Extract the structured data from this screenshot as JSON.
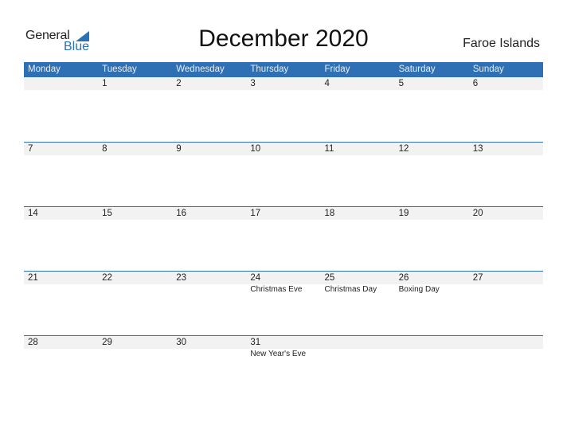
{
  "logo": {
    "general": "General",
    "blue": "Blue",
    "icon": "triangle-flag-icon"
  },
  "title": "December 2020",
  "country": "Faroe Islands",
  "colors": {
    "accent": "#2e70b3",
    "band": "#f2f2f2"
  },
  "weekdays": [
    "Monday",
    "Tuesday",
    "Wednesday",
    "Thursday",
    "Friday",
    "Saturday",
    "Sunday"
  ],
  "weeks": [
    {
      "days": [
        {
          "n": "",
          "h": ""
        },
        {
          "n": "1",
          "h": ""
        },
        {
          "n": "2",
          "h": ""
        },
        {
          "n": "3",
          "h": ""
        },
        {
          "n": "4",
          "h": ""
        },
        {
          "n": "5",
          "h": ""
        },
        {
          "n": "6",
          "h": ""
        }
      ]
    },
    {
      "days": [
        {
          "n": "7",
          "h": ""
        },
        {
          "n": "8",
          "h": ""
        },
        {
          "n": "9",
          "h": ""
        },
        {
          "n": "10",
          "h": ""
        },
        {
          "n": "11",
          "h": ""
        },
        {
          "n": "12",
          "h": ""
        },
        {
          "n": "13",
          "h": ""
        }
      ]
    },
    {
      "days": [
        {
          "n": "14",
          "h": ""
        },
        {
          "n": "15",
          "h": ""
        },
        {
          "n": "16",
          "h": ""
        },
        {
          "n": "17",
          "h": ""
        },
        {
          "n": "18",
          "h": ""
        },
        {
          "n": "19",
          "h": ""
        },
        {
          "n": "20",
          "h": ""
        }
      ]
    },
    {
      "days": [
        {
          "n": "21",
          "h": ""
        },
        {
          "n": "22",
          "h": ""
        },
        {
          "n": "23",
          "h": ""
        },
        {
          "n": "24",
          "h": "Christmas Eve"
        },
        {
          "n": "25",
          "h": "Christmas Day"
        },
        {
          "n": "26",
          "h": "Boxing Day"
        },
        {
          "n": "27",
          "h": ""
        }
      ]
    },
    {
      "days": [
        {
          "n": "28",
          "h": ""
        },
        {
          "n": "29",
          "h": ""
        },
        {
          "n": "30",
          "h": ""
        },
        {
          "n": "31",
          "h": "New Year's Eve"
        },
        {
          "n": "",
          "h": ""
        },
        {
          "n": "",
          "h": ""
        },
        {
          "n": "",
          "h": ""
        }
      ]
    }
  ]
}
